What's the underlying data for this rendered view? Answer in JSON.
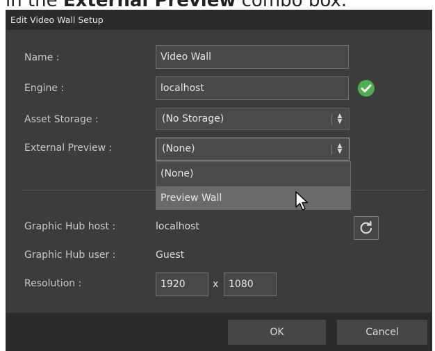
{
  "caption": {
    "text": "in the External Preview combo box.",
    "prefix": "in the ",
    "bold": "External Preview",
    "suffix": " combo box."
  },
  "dialog": {
    "title": "Edit Video Wall Setup"
  },
  "form": {
    "name": {
      "label": "Name :",
      "value": "Video Wall"
    },
    "engine": {
      "label": "Engine :",
      "value": "localhost",
      "status_icon": "check-circle-icon",
      "status_color": "#4caf50"
    },
    "asset_storage": {
      "label": "Asset Storage :",
      "selected": "(No Storage)"
    },
    "external_preview": {
      "label": "External Preview :",
      "selected": "(None)",
      "options": [
        "(None)",
        "Preview Wall"
      ],
      "hovered_option": "Preview Wall"
    }
  },
  "hub": {
    "host_label": "Graphic Hub host :",
    "host_value": "localhost",
    "user_label": "Graphic Hub user :",
    "user_value": "Guest",
    "refresh_icon": "refresh-icon"
  },
  "resolution": {
    "label": "Resolution :",
    "width": "1920",
    "separator": "x",
    "height": "1080"
  },
  "buttons": {
    "ok": "OK",
    "cancel": "Cancel"
  },
  "colors": {
    "dialog_bg": "#3c3c3c",
    "titlebar_bg": "#2b2b2b",
    "hover_bg": "#6a6a6a",
    "success": "#4caf50"
  }
}
